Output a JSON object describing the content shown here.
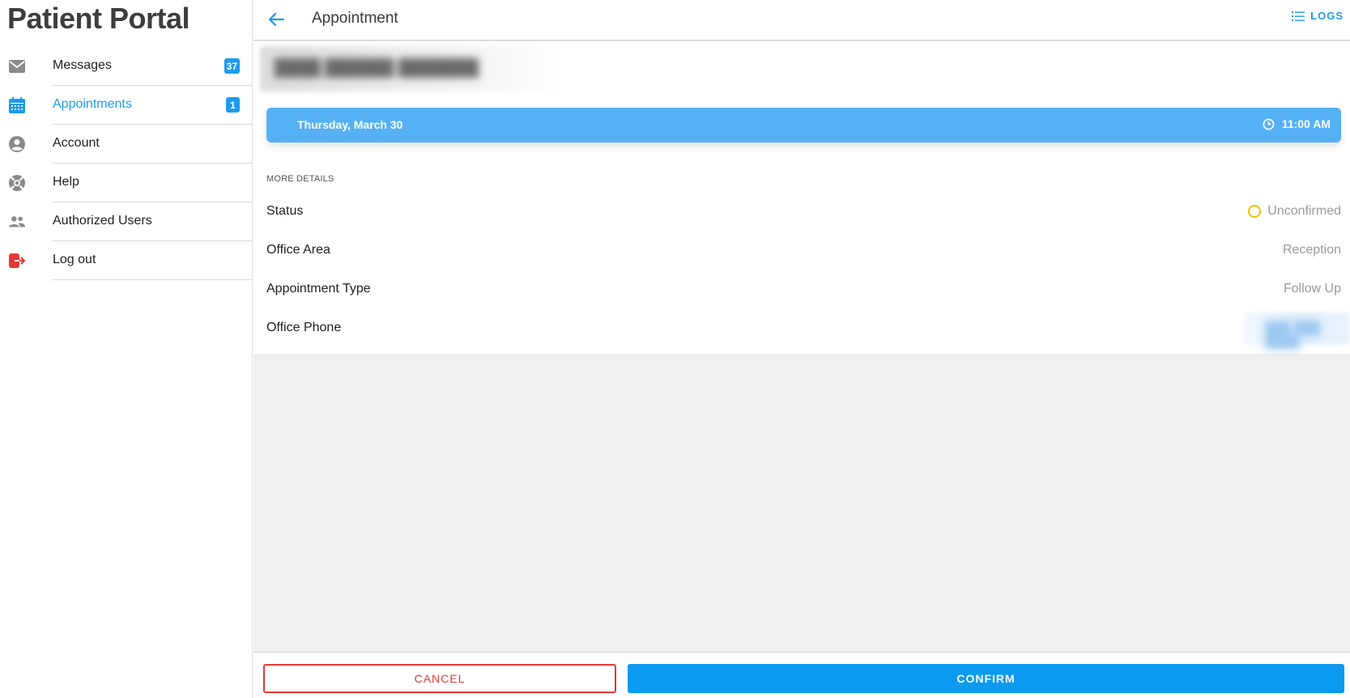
{
  "app": {
    "title": "Patient Portal"
  },
  "sidebar": {
    "items": [
      {
        "label": "Messages",
        "badge": "37",
        "icon": "envelope-icon"
      },
      {
        "label": "Appointments",
        "badge": "1",
        "icon": "calendar-icon",
        "active": true
      },
      {
        "label": "Account",
        "icon": "person-circle-icon"
      },
      {
        "label": "Help",
        "icon": "lifebuoy-icon"
      },
      {
        "label": "Authorized Users",
        "icon": "people-icon"
      },
      {
        "label": "Log out",
        "icon": "logout-icon"
      }
    ]
  },
  "header": {
    "title": "Appointment",
    "logs_label": "LOGS"
  },
  "appointment": {
    "date": "Thursday, March 30",
    "time": "11:00 AM",
    "section_label": "MORE DETAILS",
    "details": [
      {
        "label": "Status",
        "value": "Unconfirmed"
      },
      {
        "label": "Office Area",
        "value": "Reception"
      },
      {
        "label": "Appointment Type",
        "value": "Follow Up"
      },
      {
        "label": "Office Phone",
        "value": ""
      }
    ]
  },
  "actions": {
    "cancel_label": "CANCEL",
    "confirm_label": "CONFIRM"
  },
  "colors": {
    "accent": "#1e9be9",
    "date_bar": "#55b1f4",
    "confirm": "#0b9af0",
    "cancel": "#e53935",
    "status_pending": "#f2c200",
    "logout": "#e53935"
  }
}
